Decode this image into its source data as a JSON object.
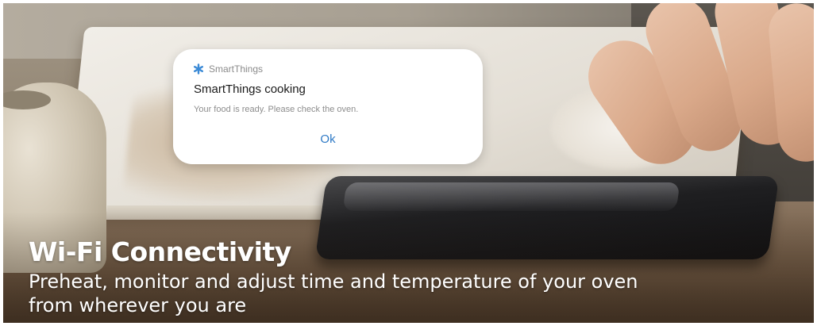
{
  "notification": {
    "app_name": "SmartThings",
    "app_icon": "asterisk-icon",
    "title": "SmartThings cooking",
    "body": "Your food is ready. Please check the oven.",
    "ok_label": "Ok",
    "accent_color": "#2f7ac6"
  },
  "caption": {
    "title": "Wi-Fi Connectivity",
    "subtitle": "Preheat, monitor and adjust time and temperature of your oven from wherever you are"
  }
}
